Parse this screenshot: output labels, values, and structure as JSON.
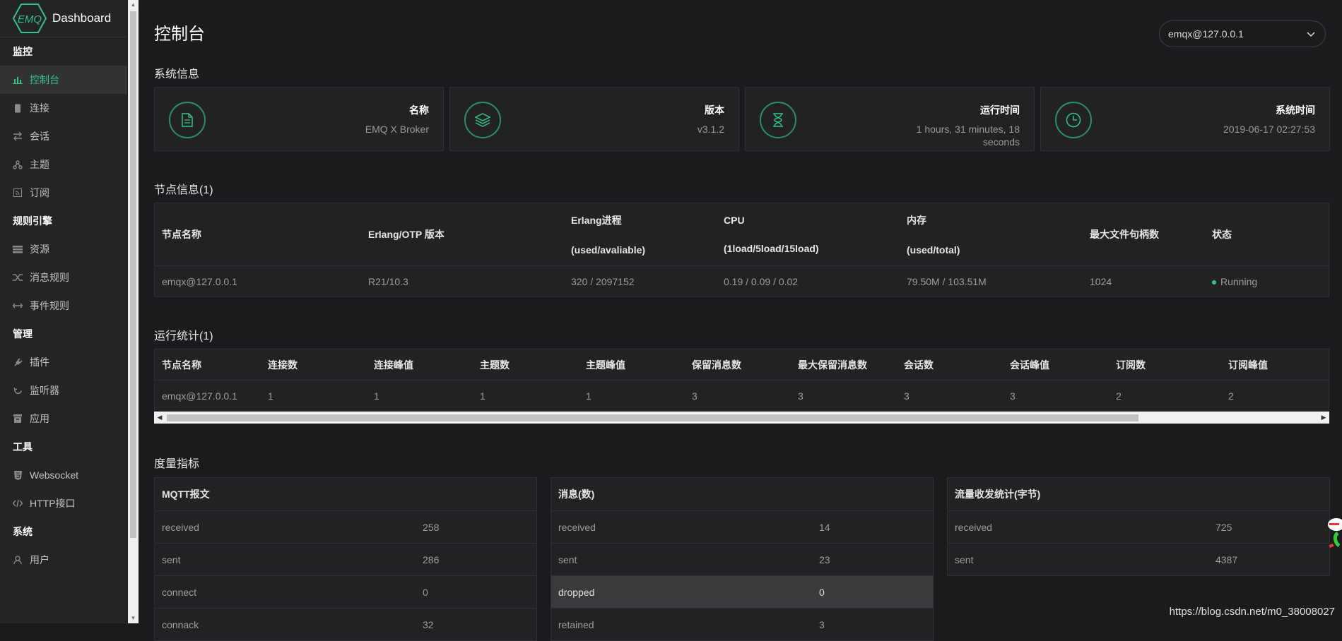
{
  "sidebar": {
    "logo_text": "EMQ",
    "app_title": "Dashboard",
    "groups": [
      {
        "title": "监控",
        "items": [
          {
            "label": "控制台",
            "icon": "bar-chart-icon",
            "active": true
          },
          {
            "label": "连接",
            "icon": "device-icon"
          },
          {
            "label": "会话",
            "icon": "swap-icon"
          },
          {
            "label": "主题",
            "icon": "topic-icon"
          },
          {
            "label": "订阅",
            "icon": "rss-icon"
          }
        ]
      },
      {
        "title": "规则引擎",
        "items": [
          {
            "label": "资源",
            "icon": "list-icon"
          },
          {
            "label": "消息规则",
            "icon": "shuffle-icon"
          },
          {
            "label": "事件规则",
            "icon": "arrows-icon"
          }
        ]
      },
      {
        "title": "管理",
        "items": [
          {
            "label": "插件",
            "icon": "plug-icon"
          },
          {
            "label": "监听器",
            "icon": "refresh-icon"
          },
          {
            "label": "应用",
            "icon": "box-icon"
          }
        ]
      },
      {
        "title": "工具",
        "items": [
          {
            "label": "Websocket",
            "icon": "html5-icon"
          },
          {
            "label": "HTTP接口",
            "icon": "code-icon"
          }
        ]
      },
      {
        "title": "系统",
        "items": [
          {
            "label": "用户",
            "icon": "user-icon"
          }
        ]
      }
    ]
  },
  "header": {
    "title": "控制台",
    "node_select": "emqx@127.0.0.1"
  },
  "system_info": {
    "title": "系统信息",
    "cards": [
      {
        "label": "名称",
        "value": "EMQ X Broker",
        "icon": "document-icon"
      },
      {
        "label": "版本",
        "value": "v3.1.2",
        "icon": "layers-icon"
      },
      {
        "label": "运行时间",
        "value": "1 hours, 31 minutes, 18 seconds",
        "icon": "hourglass-icon"
      },
      {
        "label": "系统时间",
        "value": "2019-06-17 02:27:53",
        "icon": "clock-icon"
      }
    ]
  },
  "node_info": {
    "title": "节点信息(1)",
    "headers": {
      "name": "节点名称",
      "otp": "Erlang/OTP 版本",
      "proc": "Erlang进程",
      "proc_sub": "(used/avaliable)",
      "cpu": "CPU",
      "cpu_sub": "(1load/5load/15load)",
      "mem": "内存",
      "mem_sub": "(used/total)",
      "fds": "最大文件句柄数",
      "status": "状态"
    },
    "row": {
      "name": "emqx@127.0.0.1",
      "otp": "R21/10.3",
      "proc": "320 / 2097152",
      "cpu": "0.19 / 0.09 / 0.02",
      "mem": "79.50M / 103.51M",
      "fds": "1024",
      "status": "Running"
    }
  },
  "run_stats": {
    "title": "运行统计(1)",
    "headers": [
      "节点名称",
      "连接数",
      "连接峰值",
      "主题数",
      "主题峰值",
      "保留消息数",
      "最大保留消息数",
      "会话数",
      "会话峰值",
      "订阅数",
      "订阅峰值"
    ],
    "row": [
      "emqx@127.0.0.1",
      "1",
      "1",
      "1",
      "1",
      "3",
      "3",
      "3",
      "3",
      "2",
      "2"
    ]
  },
  "metrics": {
    "title": "度量指标",
    "tables": [
      {
        "title": "MQTT报文",
        "rows": [
          [
            "received",
            "258"
          ],
          [
            "sent",
            "286"
          ],
          [
            "connect",
            "0"
          ],
          [
            "connack",
            "32"
          ]
        ]
      },
      {
        "title": "消息(数)",
        "rows": [
          [
            "received",
            "14"
          ],
          [
            "sent",
            "23"
          ],
          [
            "dropped",
            "0"
          ],
          [
            "retained",
            "3"
          ]
        ]
      },
      {
        "title": "流量收发统计(字节)",
        "rows": [
          [
            "received",
            "725"
          ],
          [
            "sent",
            "4387"
          ]
        ]
      }
    ]
  },
  "watermark": "https://blog.csdn.net/m0_38008027",
  "colors": {
    "accent": "#34c388",
    "background": "#1b1b1d",
    "panel": "#222225",
    "sidebar": "#242427"
  }
}
